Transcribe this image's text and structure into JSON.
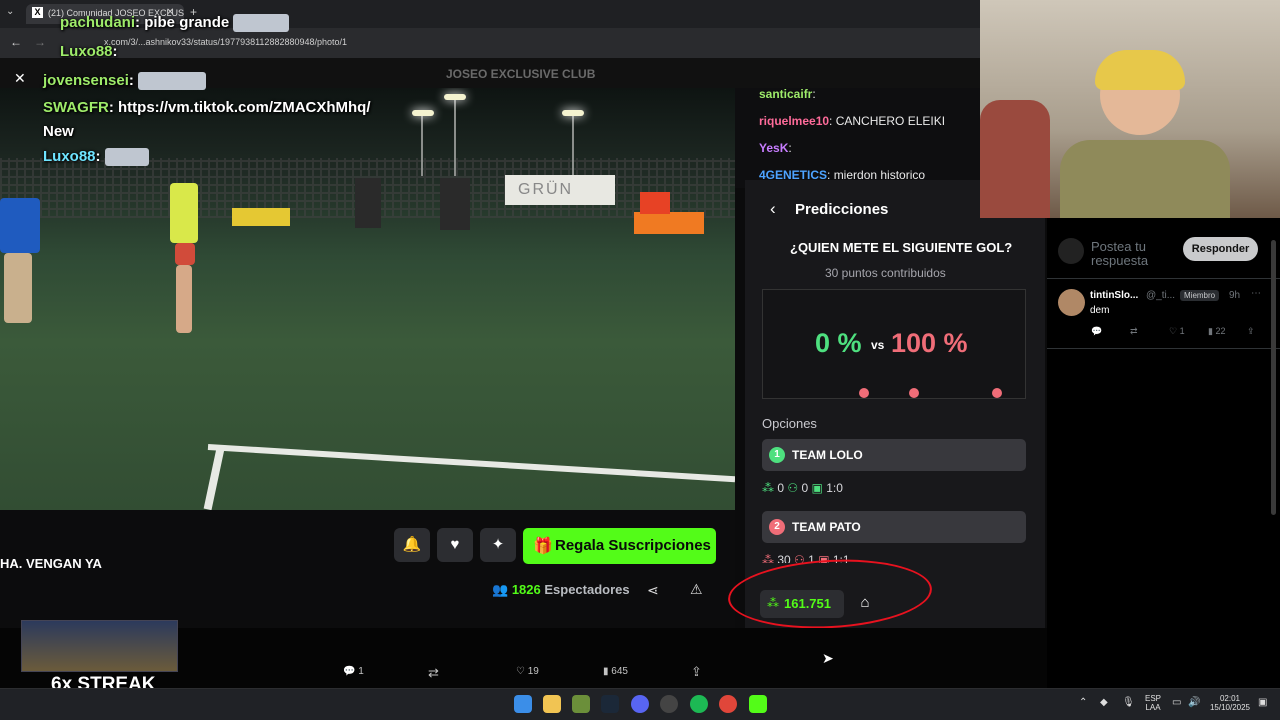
{
  "browser": {
    "tab_title": "(21) Comunidad JOSEO EXCLUS",
    "url": "x.com/3/...ashnikov33/status/1977938112882880948/photo/1",
    "header_text": "JOSEO EXCLUSIVE CLUB"
  },
  "stream_chat": [
    {
      "user": "pachudani",
      "text": "pibe grande"
    },
    {
      "user": "Luxo88",
      "text": ""
    },
    {
      "user": "jovensensei",
      "text": ""
    },
    {
      "user": "SWAGFR",
      "text": "https://vm.tiktok.com/ZMACXhMhq/"
    },
    {
      "user": "",
      "text": "New"
    },
    {
      "user": "Luxo88",
      "text": ""
    }
  ],
  "side_chat": [
    {
      "user": "santicaifr",
      "text": "",
      "color": "#9eeb6a"
    },
    {
      "user": "riquelmee10",
      "text": "CANCHERO ELEIKI",
      "color": "#ff6b9a"
    },
    {
      "user": "YesK",
      "text": "",
      "color": "#c77dff"
    },
    {
      "user": "4GENETICS",
      "text": "mierdon historico",
      "color": "#4da3ff"
    }
  ],
  "player": {
    "gift_label": "Regala Suscripciones",
    "viewers_count": "1826",
    "viewers_label": "Espectadores",
    "overlay_text": "HA. VENGAN YA"
  },
  "prediction": {
    "title": "Predicciones",
    "question": "¿QUIEN METE EL SIGUIENTE GOL?",
    "points": "30 puntos contribuidos",
    "pct_a": "0 %",
    "vs": "vs",
    "pct_b": "100 %",
    "options_label": "Opciones",
    "options": [
      {
        "num": "1",
        "label": "TEAM LOLO",
        "color": "#4ee07f",
        "points": "0",
        "users": "0",
        "ratio": "1:0"
      },
      {
        "num": "2",
        "label": "TEAM PATO",
        "color": "#f06d78",
        "points": "30",
        "users": "1",
        "ratio": "1:1"
      }
    ],
    "balance": "161.751"
  },
  "twitter": {
    "reply_placeholder": "Postea tu respuesta",
    "reply_button": "Responder",
    "tweet": {
      "user": "tintinSlo...",
      "handle": "@_ti...",
      "badge": "Miembro",
      "time": "9h",
      "text": "dem",
      "likes": "1",
      "views": "22"
    },
    "bottom": {
      "replies": "1",
      "likes": "19",
      "views": "645"
    }
  },
  "overlay": {
    "streak": "6x STREAK"
  },
  "taskbar": {
    "lang": "ESP",
    "layout": "LAA",
    "time": "02:01",
    "date": "15/10/2025"
  },
  "colors": {
    "kick_green": "#53fc18",
    "annotation_red": "#e8121f"
  }
}
